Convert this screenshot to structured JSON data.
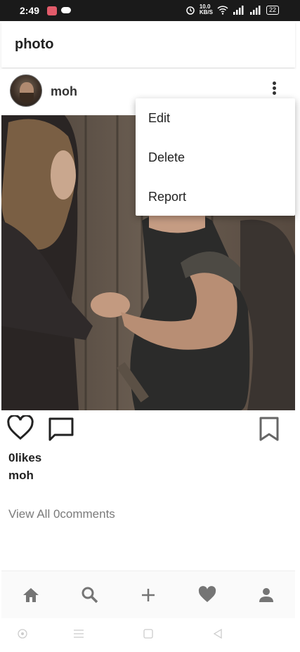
{
  "status_bar": {
    "time": "2:49",
    "net_speed": "10.0\nKB/S",
    "battery": "22"
  },
  "app_bar": {
    "title": "photo"
  },
  "post": {
    "username": "moh",
    "likes": "0likes",
    "caption_user": "moh",
    "view_comments": "View All 0comments"
  },
  "menu": {
    "items": [
      "Edit",
      "Delete",
      "Report"
    ]
  },
  "bottom_nav": {
    "items": [
      "home-icon",
      "search-icon",
      "add-icon",
      "heart-icon",
      "profile-icon"
    ]
  },
  "colors": {
    "status_bg": "#1a1a1a",
    "icon_gray": "#757575",
    "text_dark": "#222222"
  }
}
